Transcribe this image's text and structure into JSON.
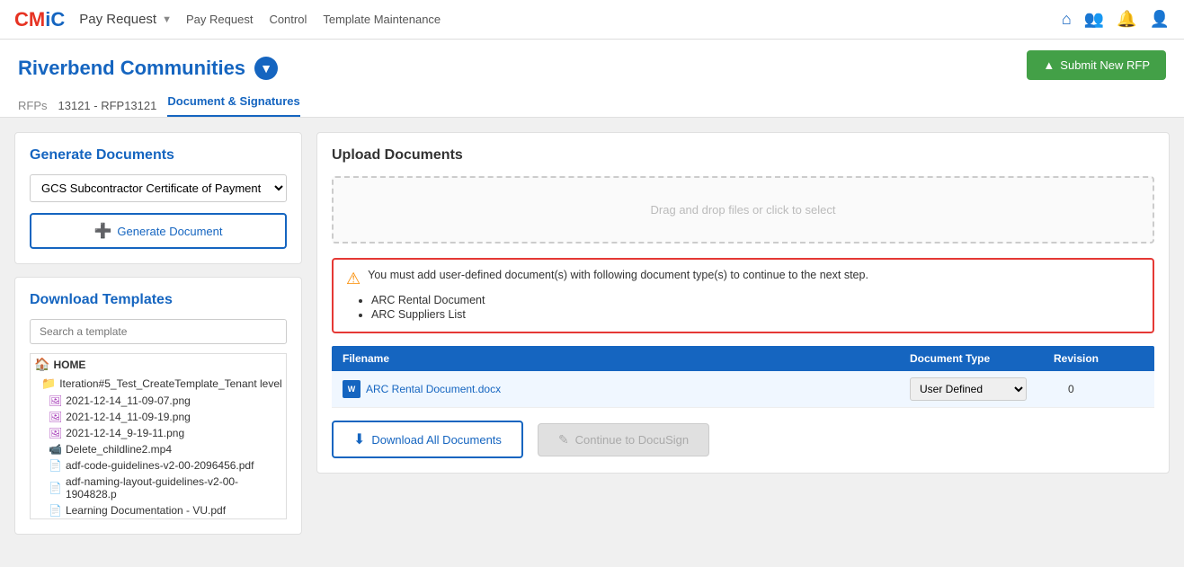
{
  "app": {
    "logo_cm": "CM",
    "logo_ic": "iC",
    "app_title": "Pay Request",
    "nav_links": [
      "Pay Request",
      "Control",
      "Template Maintenance"
    ],
    "nav_icons": [
      "home",
      "people",
      "bell",
      "user"
    ]
  },
  "header": {
    "company_name": "Riverbend Communities",
    "breadcrumb_label": "RFPs",
    "breadcrumb_link": "13121 - RFP13121",
    "breadcrumb_active": "Document & Signatures",
    "submit_btn": "Submit New RFP"
  },
  "left_panel": {
    "generate_title": "Generate Documents",
    "doc_select_value": "GCS Subcontractor Certificate of Payment",
    "generate_btn": "Generate Document",
    "download_title": "Download Templates",
    "search_placeholder": "Search a template",
    "tree": {
      "home": "HOME",
      "folder": "Iteration#5_Test_CreateTemplate_Tenant level",
      "files": [
        {
          "name": "2021-12-14_11-09-07.png",
          "type": "img"
        },
        {
          "name": "2021-12-14_11-09-19.png",
          "type": "img"
        },
        {
          "name": "2021-12-14_9-19-11.png",
          "type": "img"
        },
        {
          "name": "Delete_childline2.mp4",
          "type": "vid"
        },
        {
          "name": "adf-code-guidelines-v2-00-2096456.pdf",
          "type": "pdf"
        },
        {
          "name": "adf-naming-layout-guidelines-v2-00-1904828.p",
          "type": "pdf"
        },
        {
          "name": "Learning Documentation - VU.pdf",
          "type": "pdf"
        }
      ]
    }
  },
  "right_panel": {
    "upload_title": "Upload Documents",
    "drop_zone": "Drag and drop files or click to select",
    "alert_text": "You must add user-defined document(s) with following document type(s) to continue to the next step.",
    "alert_items": [
      "ARC Rental Document",
      "ARC Suppliers List"
    ],
    "table_headers": [
      "Filename",
      "Document Type",
      "Revision"
    ],
    "table_rows": [
      {
        "filename": "ARC Rental Document.docx",
        "doc_type": "User Defined",
        "revision": "0"
      }
    ],
    "doc_type_options": [
      "User Defined",
      "ARC Rental Document",
      "ARC Suppliers List"
    ],
    "download_all_btn": "Download All Documents",
    "continue_btn": "Continue to DocuSign"
  }
}
